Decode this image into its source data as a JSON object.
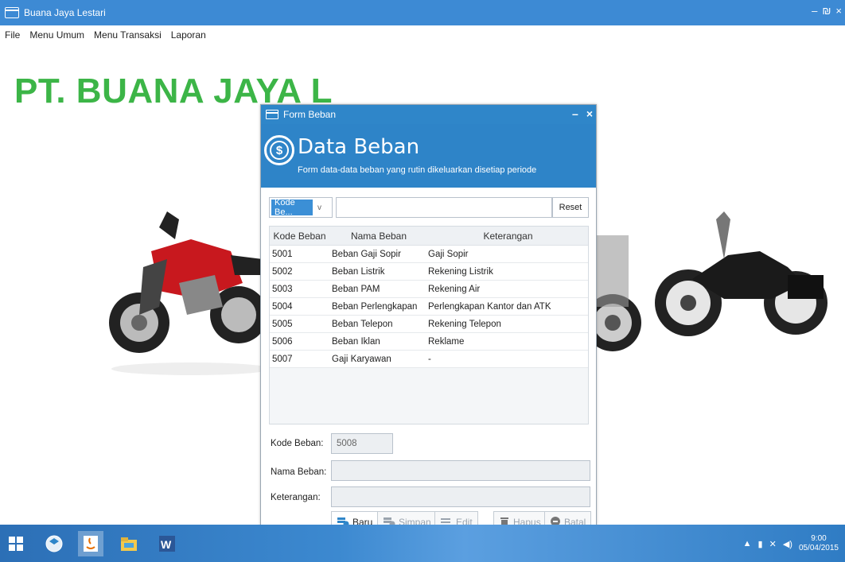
{
  "app": {
    "title": "Buana Jaya Lestari",
    "controls": {
      "minimize": "–",
      "restore": "₪",
      "close": "×"
    }
  },
  "menubar": [
    "File",
    "Menu Umum",
    "Menu Transaksi",
    "Laporan"
  ],
  "company_name": "PT. BUANA JAYA L",
  "form": {
    "title": "Form Beban",
    "controls": {
      "minimize": "–",
      "close": "×"
    },
    "header": {
      "title": "Data Beban",
      "subtitle": "Form data-data beban yang rutin dikeluarkan disetiap periode",
      "icon": "dollar-coin-icon"
    },
    "search": {
      "field_selected": "Kode Be...",
      "input_value": "",
      "reset_label": "Reset"
    },
    "table": {
      "columns": [
        "Kode Beban",
        "Nama Beban",
        "Keterangan"
      ],
      "rows": [
        [
          "5001",
          "Beban Gaji Sopir",
          "Gaji Sopir"
        ],
        [
          "5002",
          "Beban Listrik",
          "Rekening Listrik"
        ],
        [
          "5003",
          "Beban PAM",
          "Rekening Air"
        ],
        [
          "5004",
          "Beban Perlengkapan",
          "Perlengkapan Kantor dan ATK"
        ],
        [
          "5005",
          "Beban Telepon",
          "Rekening Telepon"
        ],
        [
          "5006",
          "Beban Iklan",
          "Reklame"
        ],
        [
          "5007",
          "Gaji Karyawan",
          "-"
        ]
      ]
    },
    "fields": {
      "kode_label": "Kode Beban:",
      "kode_value": "5008",
      "nama_label": "Nama Beban:",
      "nama_value": "",
      "ket_label": "Keterangan:",
      "ket_value": ""
    },
    "buttons": {
      "baru": "Baru",
      "simpan": "Simpan",
      "edit": "Edit",
      "hapus": "Hapus",
      "batal": "Batal"
    }
  },
  "taskbar": {
    "apps": [
      "windows-start-icon",
      "box-app-icon",
      "java-icon",
      "file-explorer-icon",
      "word-icon"
    ],
    "clock_time": "9:00",
    "clock_date": "05/04/2015"
  }
}
